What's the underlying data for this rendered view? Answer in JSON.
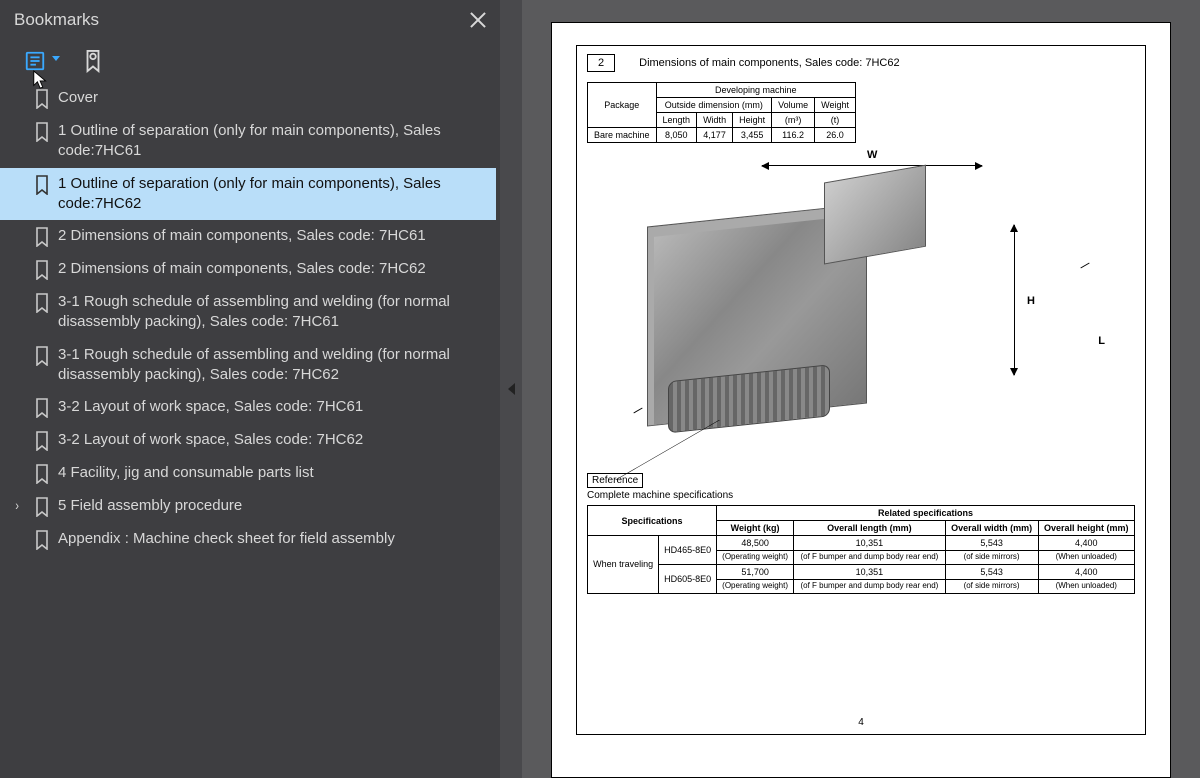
{
  "sidebar": {
    "title": "Bookmarks",
    "items": [
      {
        "label": "Cover",
        "selected": false,
        "expandable": false
      },
      {
        "label": "1 Outline of separation (only for main components), Sales code:7HC61",
        "selected": false,
        "expandable": false
      },
      {
        "label": "1 Outline of separation (only for main components), Sales code:7HC62",
        "selected": true,
        "expandable": false
      },
      {
        "label": "2 Dimensions of main components, Sales code: 7HC61",
        "selected": false,
        "expandable": false
      },
      {
        "label": "2 Dimensions of main components, Sales code: 7HC62",
        "selected": false,
        "expandable": false
      },
      {
        "label": "3-1 Rough schedule of assembling and welding (for normal disassembly packing), Sales code: 7HC61",
        "selected": false,
        "expandable": false
      },
      {
        "label": "3-1 Rough schedule of assembling and welding (for normal disassembly packing), Sales code: 7HC62",
        "selected": false,
        "expandable": false
      },
      {
        "label": "3-2 Layout of work space, Sales code: 7HC61",
        "selected": false,
        "expandable": false
      },
      {
        "label": "3-2 Layout of work space, Sales code: 7HC62",
        "selected": false,
        "expandable": false
      },
      {
        "label": "4 Facility, jig and consumable parts list",
        "selected": false,
        "expandable": false
      },
      {
        "label": "5 Field assembly procedure",
        "selected": false,
        "expandable": true
      },
      {
        "label": "Appendix : Machine check sheet for field assembly",
        "selected": false,
        "expandable": false
      }
    ]
  },
  "page": {
    "section_number": "2",
    "section_title": "Dimensions of main components, Sales code: 7HC62",
    "table1": {
      "super_header": "Developing machine",
      "dim_header": "Outside dimension (mm)",
      "vol_header": "Volume",
      "wt_header": "Weight",
      "package_header": "Package",
      "col_length": "Length",
      "col_width": "Width",
      "col_height": "Height",
      "col_vol_unit": "(m³)",
      "col_wt_unit": "(t)",
      "row_label": "Bare machine",
      "length": "8,050",
      "width": "4,177",
      "height": "3,455",
      "volume": "116.2",
      "weight": "26.0"
    },
    "dims": {
      "w": "W",
      "h": "H",
      "l": "L"
    },
    "ref_label": "Reference",
    "ref_sub": "Complete machine specifications",
    "table2": {
      "rel_header": "Related specifications",
      "spec_header": "Specifications",
      "wt_header": "Weight (kg)",
      "len_header": "Overall length (mm)",
      "wid_header": "Overall width (mm)",
      "hgt_header": "Overall height (mm)",
      "when_traveling": "When traveling",
      "model_a": "HD465-8E0",
      "model_b": "HD605-8E0",
      "wt_a": "48,500",
      "wt_b": "51,700",
      "wt_note": "(Operating weight)",
      "len_a": "10,351",
      "len_b": "10,351",
      "len_note": "(of F bumper and dump body rear end)",
      "wid_a": "5,543",
      "wid_b": "5,543",
      "wid_note": "(of side mirrors)",
      "hgt_a": "4,400",
      "hgt_b": "4,400",
      "hgt_note": "(When unloaded)"
    },
    "page_number": "4"
  },
  "chart_data": {
    "type": "table",
    "title": "Dimensions of main components, Sales code: 7HC62",
    "developing_machine": {
      "package": "Bare machine",
      "length_mm": 8050,
      "width_mm": 4177,
      "height_mm": 3455,
      "volume_m3": 116.2,
      "weight_t": 26.0
    },
    "related_specifications": [
      {
        "model": "HD465-8E0",
        "condition": "When traveling",
        "weight_kg": 48500,
        "weight_note": "Operating weight",
        "overall_length_mm": 10351,
        "length_note": "of F bumper and dump body rear end",
        "overall_width_mm": 5543,
        "width_note": "of side mirrors",
        "overall_height_mm": 4400,
        "height_note": "When unloaded"
      },
      {
        "model": "HD605-8E0",
        "condition": "When traveling",
        "weight_kg": 51700,
        "weight_note": "Operating weight",
        "overall_length_mm": 10351,
        "length_note": "of F bumper and dump body rear end",
        "overall_width_mm": 5543,
        "width_note": "of side mirrors",
        "overall_height_mm": 4400,
        "height_note": "When unloaded"
      }
    ]
  }
}
